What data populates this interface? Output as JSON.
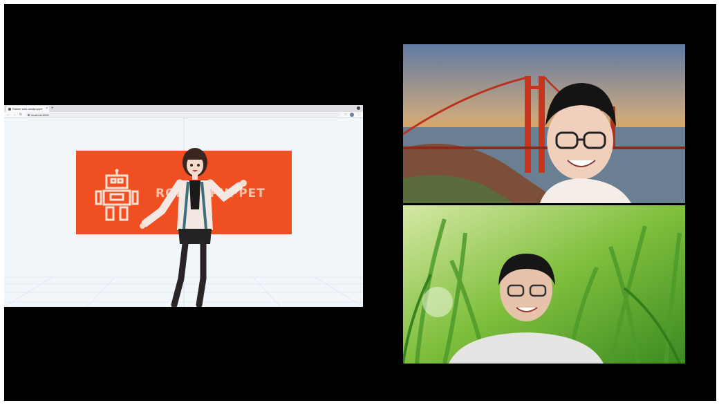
{
  "browser": {
    "tab_title": "Rainier web-sandpuppet",
    "new_tab_symbol": "+",
    "close_symbol": "×",
    "back_symbol": "←",
    "forward_symbol": "→",
    "reload_symbol": "↻",
    "url": "localhost:8080",
    "star_symbol": "☆",
    "menu_symbol": "⋮"
  },
  "banner": {
    "text": "ROBOT PUPPET",
    "background_color": "#f04f22",
    "text_color": "#f9c3a9"
  },
  "icons": {
    "robot": "robot-logo-icon",
    "favicon": "favicon-icon",
    "lock": "lock-icon",
    "profile": "profile-icon"
  },
  "video_tiles": [
    {
      "name": "participant-golden-gate-background"
    },
    {
      "name": "participant-grass-background"
    }
  ]
}
